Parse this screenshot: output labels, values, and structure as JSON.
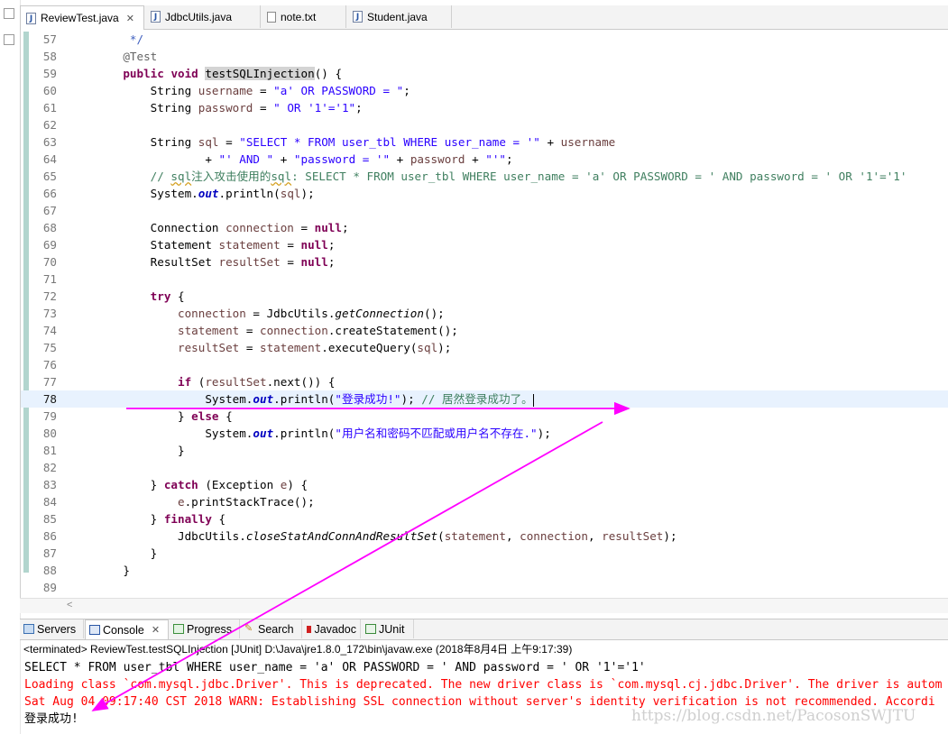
{
  "editor_tabs": [
    {
      "label": "ReviewTest.java",
      "icon": "java-file-icon",
      "active": true
    },
    {
      "label": "JdbcUtils.java",
      "icon": "java-file-icon",
      "active": false
    },
    {
      "label": "note.txt",
      "icon": "text-file-icon",
      "active": false
    },
    {
      "label": "Student.java",
      "icon": "java-file-icon",
      "active": false
    }
  ],
  "code_lines": [
    {
      "n": "57",
      "html": "    <span class=\"doc\"> */</span>"
    },
    {
      "n": "58",
      "html": "    <span class=\"ann\">@Test</span>"
    },
    {
      "n": "59",
      "html": "    <span class=\"kw\">public</span> <span class=\"kw\">void</span> <span class=\"occ\">testSQLInjection</span>() {"
    },
    {
      "n": "60",
      "html": "        String <span class=\"var\">username</span> = <span class=\"str\">\"a' OR PASSWORD = \"</span>;"
    },
    {
      "n": "61",
      "html": "        String <span class=\"var\">password</span> = <span class=\"str\">\" OR '1'='1\"</span>;"
    },
    {
      "n": "62",
      "html": ""
    },
    {
      "n": "63",
      "html": "        String <span class=\"var\">sql</span> = <span class=\"str\">\"SELECT * FROM user_tbl WHERE user_name = '\"</span> + <span class=\"var\">username</span>"
    },
    {
      "n": "64",
      "html": "                + <span class=\"str\">\"' AND \"</span> + <span class=\"str\">\"password = '\"</span> + <span class=\"var\">password</span> + <span class=\"str\">\"'\"</span>;"
    },
    {
      "n": "65",
      "html": "        <span class=\"cm\">// <span class=\"squig\">sql</span>注入攻击使用的<span class=\"squig\">sql</span>: SELECT * FROM user_tbl WHERE user_name = 'a' OR PASSWORD = ' AND password = ' OR '1'='1'</span>"
    },
    {
      "n": "66",
      "html": "        System.<span class=\"fld\">out</span>.println(<span class=\"var\">sql</span>);"
    },
    {
      "n": "67",
      "html": ""
    },
    {
      "n": "68",
      "html": "        Connection <span class=\"var\">connection</span> = <span class=\"kw\">null</span>;"
    },
    {
      "n": "69",
      "html": "        Statement <span class=\"var\">statement</span> = <span class=\"kw\">null</span>;"
    },
    {
      "n": "70",
      "html": "        ResultSet <span class=\"var\">resultSet</span> = <span class=\"kw\">null</span>;"
    },
    {
      "n": "71",
      "html": ""
    },
    {
      "n": "72",
      "html": "        <span class=\"kw\">try</span> {"
    },
    {
      "n": "73",
      "html": "            <span class=\"var\">connection</span> = JdbcUtils.<span class=\"ita\">getConnection</span>();"
    },
    {
      "n": "74",
      "html": "            <span class=\"var\">statement</span> = <span class=\"var\">connection</span>.createStatement();"
    },
    {
      "n": "75",
      "html": "            <span class=\"var\">resultSet</span> = <span class=\"var\">statement</span>.executeQuery(<span class=\"var\">sql</span>);"
    },
    {
      "n": "76",
      "html": ""
    },
    {
      "n": "77",
      "html": "            <span class=\"kw\">if</span> (<span class=\"var\">resultSet</span>.next()) {"
    },
    {
      "n": "78",
      "html": "                System.<span class=\"fld\">out</span>.println(<span class=\"str\">\"登录成功!\"</span>); <span class=\"cm\">// 居然登录成功了。</span><span class=\"caret-bar\"></span>",
      "current": true
    },
    {
      "n": "79",
      "html": "            } <span class=\"kw\">else</span> {"
    },
    {
      "n": "80",
      "html": "                System.<span class=\"fld\">out</span>.println(<span class=\"str\">\"用户名和密码不匹配或用户名不存在.\"</span>);"
    },
    {
      "n": "81",
      "html": "            }"
    },
    {
      "n": "82",
      "html": ""
    },
    {
      "n": "83",
      "html": "        } <span class=\"kw\">catch</span> (Exception <span class=\"var\">e</span>) {"
    },
    {
      "n": "84",
      "html": "            <span class=\"var\">e</span>.printStackTrace();"
    },
    {
      "n": "85",
      "html": "        } <span class=\"kw\">finally</span> {"
    },
    {
      "n": "86",
      "html": "            JdbcUtils.<span class=\"ita\">closeStatAndConnAndResultSet</span>(<span class=\"var\">statement</span>, <span class=\"var\">connection</span>, <span class=\"var\">resultSet</span>);"
    },
    {
      "n": "87",
      "html": "        }"
    },
    {
      "n": "88",
      "html": "    }"
    },
    {
      "n": "89",
      "html": ""
    }
  ],
  "console_tabs": [
    {
      "label": "Servers",
      "icon": "servers-icon",
      "color": "#3a6fb0"
    },
    {
      "label": "Console",
      "icon": "console-icon",
      "color": "#2a56a5",
      "active": true
    },
    {
      "label": "Progress",
      "icon": "progress-icon",
      "color": "#3c8f3c"
    },
    {
      "label": "Search",
      "icon": "search-icon",
      "color": "#c08a2a"
    },
    {
      "label": "Javadoc",
      "icon": "javadoc-icon",
      "color": "#d02020"
    },
    {
      "label": "JUnit",
      "icon": "junit-icon",
      "color": "#3a8a3a"
    }
  ],
  "console_status": "<terminated> ReviewTest.testSQLInjection [JUnit] D:\\Java\\jre1.8.0_172\\bin\\javaw.exe (2018年8月4日 上午9:17:39)",
  "console_output": [
    {
      "text": "SELECT * FROM user_tbl WHERE user_name = 'a' OR PASSWORD = ' AND password = ' OR '1'='1'",
      "error": false
    },
    {
      "text": "Loading class `com.mysql.jdbc.Driver'. This is deprecated. The new driver class is `com.mysql.cj.jdbc.Driver'. The driver is autom",
      "error": true
    },
    {
      "text": "Sat Aug 04 09:17:40 CST 2018 WARN: Establishing SSL connection without server's identity verification is not recommended. Accordi",
      "error": true
    },
    {
      "text": "登录成功!",
      "error": false
    }
  ],
  "watermark": "https://blog.csdn.net/PacosonSWJTU",
  "annotation_color": "#ff00ff"
}
